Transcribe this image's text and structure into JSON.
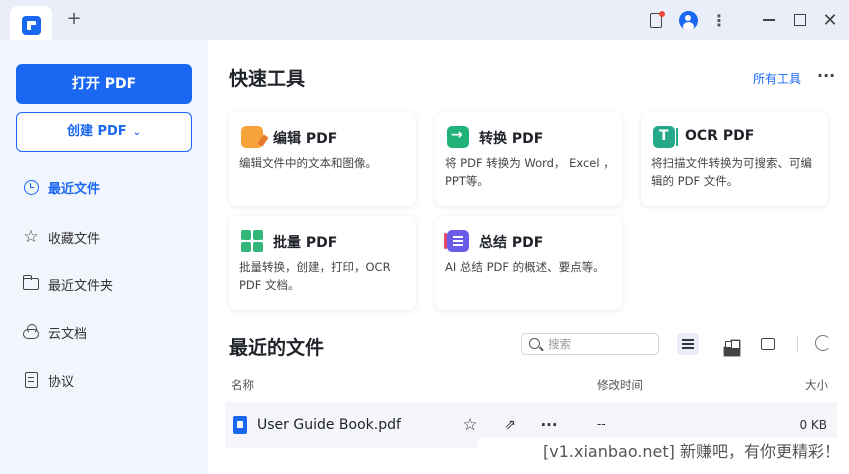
{
  "titlebar": {
    "icons": [
      "app-logo-icon",
      "plus-icon",
      "notification-icon",
      "user-avatar-icon",
      "more-vertical-icon",
      "minimize-icon",
      "maximize-icon",
      "close-icon"
    ],
    "plus": "+",
    "dots": "⋮",
    "close": "✕"
  },
  "sidebar": {
    "open_label": "打开 PDF",
    "create_label": "创建 PDF",
    "create_chevron": "⌄",
    "items": [
      {
        "label": "最近文件",
        "icon": "clock-icon",
        "active": true
      },
      {
        "label": "收藏文件",
        "icon": "star-icon",
        "active": false
      },
      {
        "label": "最近文件夹",
        "icon": "folder-icon",
        "active": false
      },
      {
        "label": "云文档",
        "icon": "cloud-icon",
        "active": false
      },
      {
        "label": "协议",
        "icon": "document-icon",
        "active": false
      }
    ]
  },
  "quick_tools": {
    "title": "快速工具",
    "all_tools": "所有工具",
    "more": "···",
    "cards": [
      {
        "title": "编辑 PDF",
        "desc": "编辑文件中的文本和图像。",
        "icon": "edit-pdf-icon"
      },
      {
        "title": "转换 PDF",
        "desc": "将 PDF 转换为 Word， Excel ，PPT等。",
        "icon": "convert-pdf-icon"
      },
      {
        "title": "OCR PDF",
        "desc": "将扫描文件转换为可搜索、可编辑的 PDF 文件。",
        "icon": "ocr-pdf-icon"
      },
      {
        "title": "批量 PDF",
        "desc": "批量转换，创建，打印，OCR PDF 文档。",
        "icon": "batch-pdf-icon"
      },
      {
        "title": "总结 PDF",
        "desc": "AI 总结 PDF 的概述、要点等。",
        "icon": "summarize-pdf-icon"
      }
    ]
  },
  "recent": {
    "title": "最近的文件",
    "search_placeholder": "搜索",
    "columns": {
      "name": "名称",
      "modified": "修改时间",
      "size": "大小"
    },
    "files": [
      {
        "name": "User Guide Book.pdf",
        "modified": "--",
        "size": "0 KB"
      }
    ],
    "row_actions": {
      "star": "☆",
      "share": "⇗",
      "more": "···"
    }
  },
  "watermark": "[v1.xianbao.net] 新赚吧，有你更精彩！",
  "colors": {
    "accent": "#1a67f2",
    "sidebar_bg": "#f1f5fc",
    "titlebar_bg": "#e9eef8"
  }
}
